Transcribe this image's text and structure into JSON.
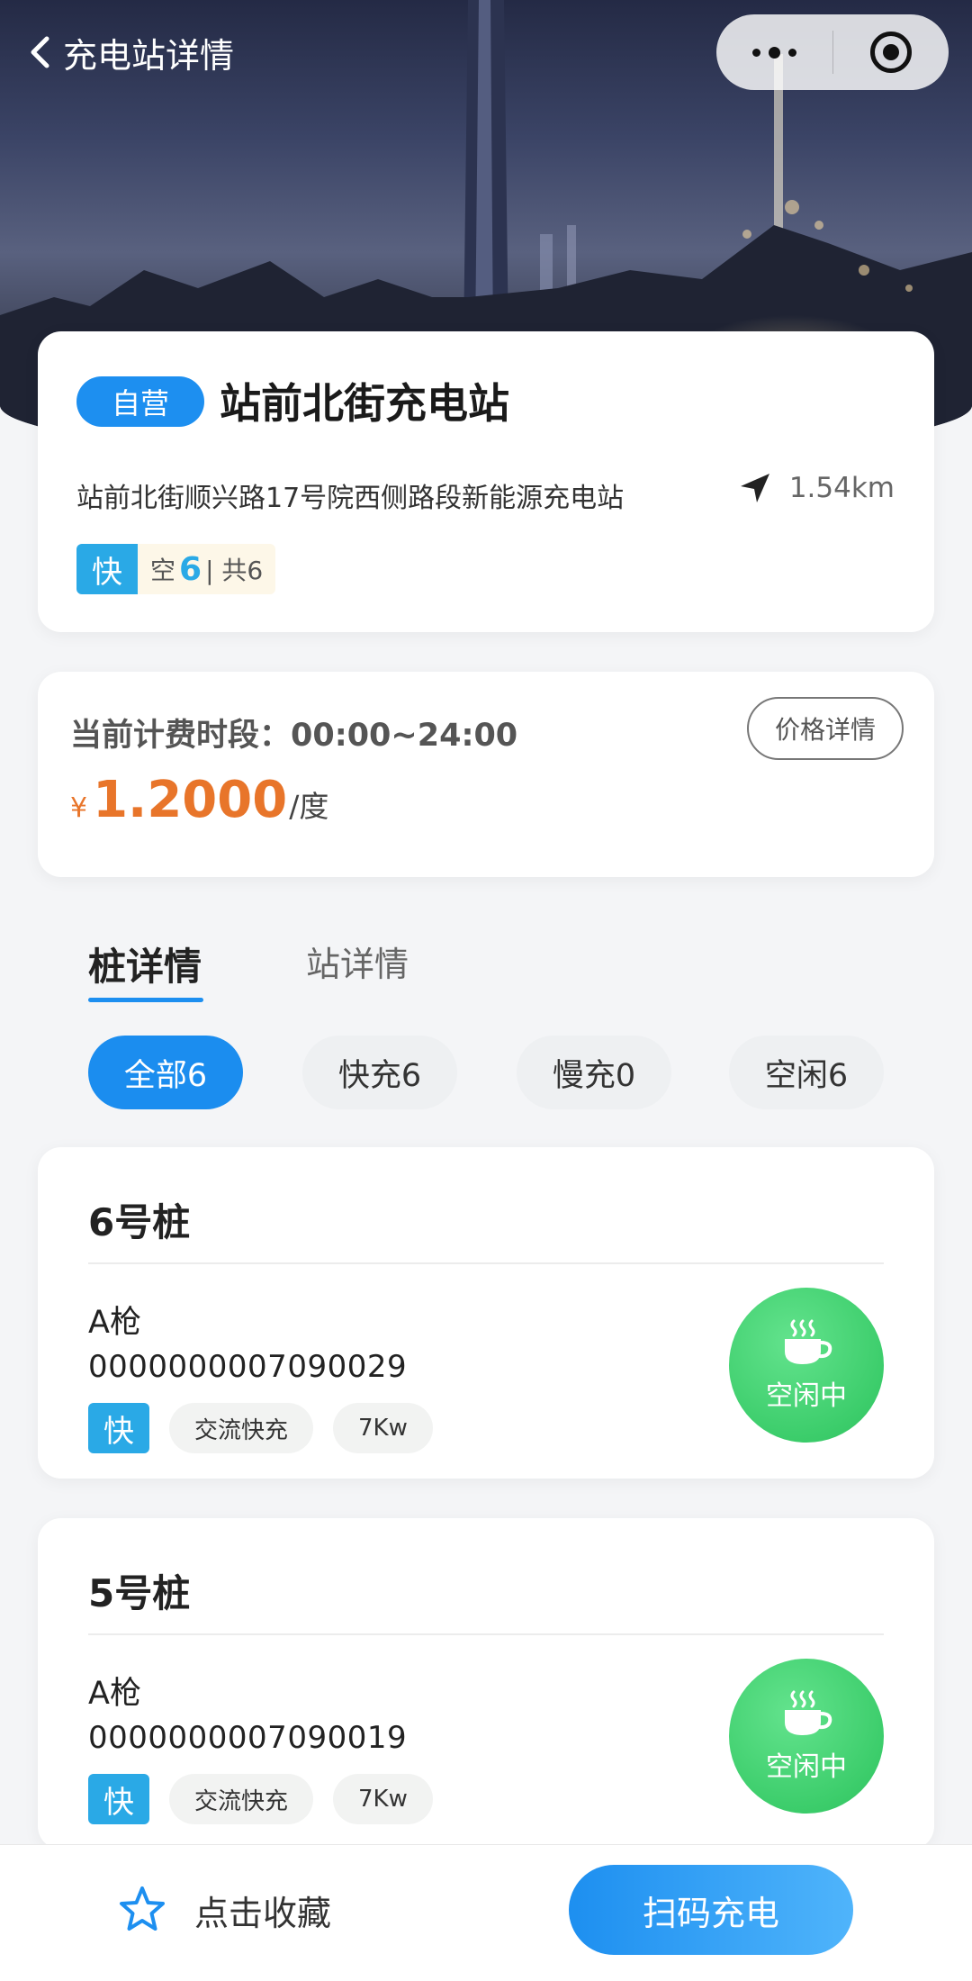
{
  "nav": {
    "title": "充电站详情"
  },
  "station": {
    "tag": "自营",
    "name": "站前北街充电站",
    "address": "站前北街顺兴路17号院西侧路段新能源充电站",
    "distance": "1.54km",
    "fast_label": "快",
    "free_prefix": "空",
    "free_count": "6",
    "total": "| 共6"
  },
  "pricing": {
    "period": "当前计费时段：00:00~24:00",
    "detail_button": "价格详情",
    "currency": "¥",
    "price": "1.2000",
    "unit": "/度"
  },
  "tabs": [
    "桩详情",
    "站详情"
  ],
  "filters": [
    "全部6",
    "快充6",
    "慢充0",
    "空闲6"
  ],
  "piles": [
    {
      "title": "6号桩",
      "gun": "A枪",
      "code": "0000000007090029",
      "fast": "快",
      "type": "交流快充",
      "power": "7Kw",
      "status": "空闲中"
    },
    {
      "title": "5号桩",
      "gun": "A枪",
      "code": "0000000007090019",
      "fast": "快",
      "type": "交流快充",
      "power": "7Kw",
      "status": "空闲中"
    }
  ],
  "bottom": {
    "favorite": "点击收藏",
    "scan": "扫码充电"
  },
  "colors": {
    "primary": "#1d8ff0",
    "price": "#e8752a",
    "idle": "#3ccd6b",
    "fast_tag": "#2aa9e6"
  }
}
